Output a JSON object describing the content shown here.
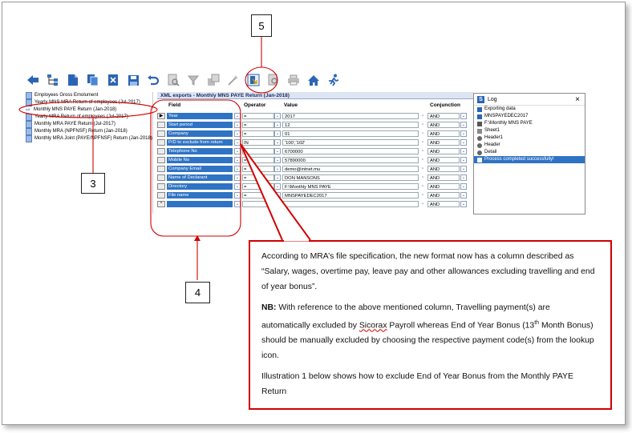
{
  "callouts": {
    "c3": "3",
    "c4": "4",
    "c5": "5"
  },
  "tree": {
    "items": [
      "Employees Gross Emolument",
      "Yearly MNS MRA Return of employees (Jul-2017)",
      "Monthly MNS PAYE Return (Jan-2018)",
      "Yearly MRA Return of employees (Jul-2017)",
      "Monthly MRA PAYE Return (Jul-2017)",
      "Monthly MRA (NPFNSF) Return (Jan-2018)",
      "Monthly MRA Joint (PAYE/NPFNSF) Return (Jan-2018)"
    ]
  },
  "grid": {
    "title": "XML exports - Monthly MNS PAYE Return (Jan-2018)",
    "headers": {
      "field": "Field",
      "operator": "Operator",
      "value": "Value",
      "conjunction": "Conjunction"
    },
    "rows": [
      {
        "field": "Year",
        "operator": "=",
        "value": "2017",
        "conj": "AND"
      },
      {
        "field": "Start period",
        "operator": "=",
        "value": "12",
        "conj": "AND"
      },
      {
        "field": "Company",
        "operator": "=",
        "value": "01",
        "conj": "AND"
      },
      {
        "field": "P/D to exclude from return",
        "operator": "IN",
        "value": "'100','102'",
        "conj": "AND"
      },
      {
        "field": "Telephone No",
        "operator": "=",
        "value": "6700000",
        "conj": "AND"
      },
      {
        "field": "Mobile No",
        "operator": "=",
        "value": "57890000",
        "conj": "AND"
      },
      {
        "field": "Company Email",
        "operator": "=",
        "value": "demo@intnet.mu",
        "conj": "AND"
      },
      {
        "field": "Name of Declarant",
        "operator": "=",
        "value": "DON MANSONS",
        "conj": "AND"
      },
      {
        "field": "Directory",
        "operator": "=",
        "value": "F:\\Monthly MNS PAYE",
        "conj": "AND"
      },
      {
        "field": "File name",
        "operator": "=",
        "value": "MNSPAYEDEC2017",
        "conj": "AND"
      },
      {
        "field": "",
        "operator": "",
        "value": "",
        "conj": "AND"
      }
    ]
  },
  "log": {
    "title": "Log",
    "close": "×",
    "items": [
      "Exporting data",
      "MNSPAYEDEC2017",
      "F:\\Monthly MNS PAYE",
      "Sheet1",
      "Header1",
      "Header",
      "Detail",
      "Process completed successfully!"
    ]
  },
  "note": {
    "p1": "According to MRA’s file specification, the new format  now has a column described as “Salary, wages, overtime pay, leave pay and other allowances excluding travelling and end of year bonus”.",
    "p2_label": "NB:",
    "p2_a": " With reference to the  above mentioned column, Travelling payment(s) are automatically  excluded by ",
    "p2_word": "Sicorax",
    "p2_b": " Payroll whereas End of Year Bonus (13",
    "p2_sup": "th",
    "p2_c": " Month Bonus) should be manually excluded by choosing the respective payment code(s) from the lookup icon.",
    "p3": "Illustration 1 below shows how to exclude End of Year Bonus from the Monthly PAYE Return"
  },
  "colors": {
    "accent_red": "#d00000",
    "field_blue": "#2f73c4"
  }
}
